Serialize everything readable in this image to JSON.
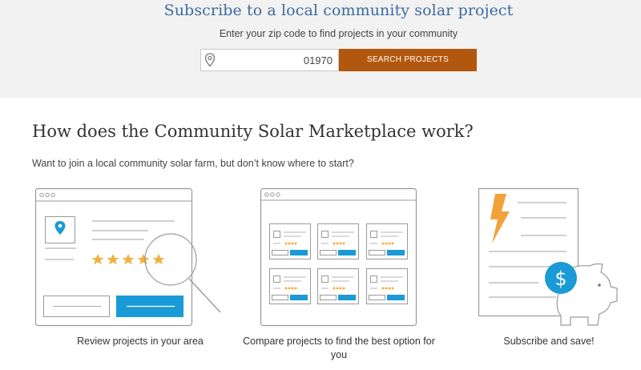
{
  "hero": {
    "title": "Subscribe to a local community solar project",
    "subtitle": "Enter your zip code to find projects in your community",
    "zip_value": "01970",
    "search_button_label": "SEARCH PROJECTS"
  },
  "how_it_works": {
    "title": "How does the Community Solar Marketplace work?",
    "subtitle": "Want to join a local community solar farm, but don’t know where to start?",
    "steps": [
      {
        "label": "Review projects in your area",
        "icon": "review-projects-illustration"
      },
      {
        "label": "Compare projects to find the best option for you",
        "icon": "compare-projects-illustration"
      },
      {
        "label": "Subscribe and save!",
        "icon": "subscribe-save-illustration"
      }
    ]
  },
  "colors": {
    "accent_blue": "#3b6aa0",
    "button_orange": "#b2570e",
    "icon_blue": "#1a9ad6",
    "star_gold": "#f0b03c",
    "bolt_orange": "#f2a23a"
  }
}
